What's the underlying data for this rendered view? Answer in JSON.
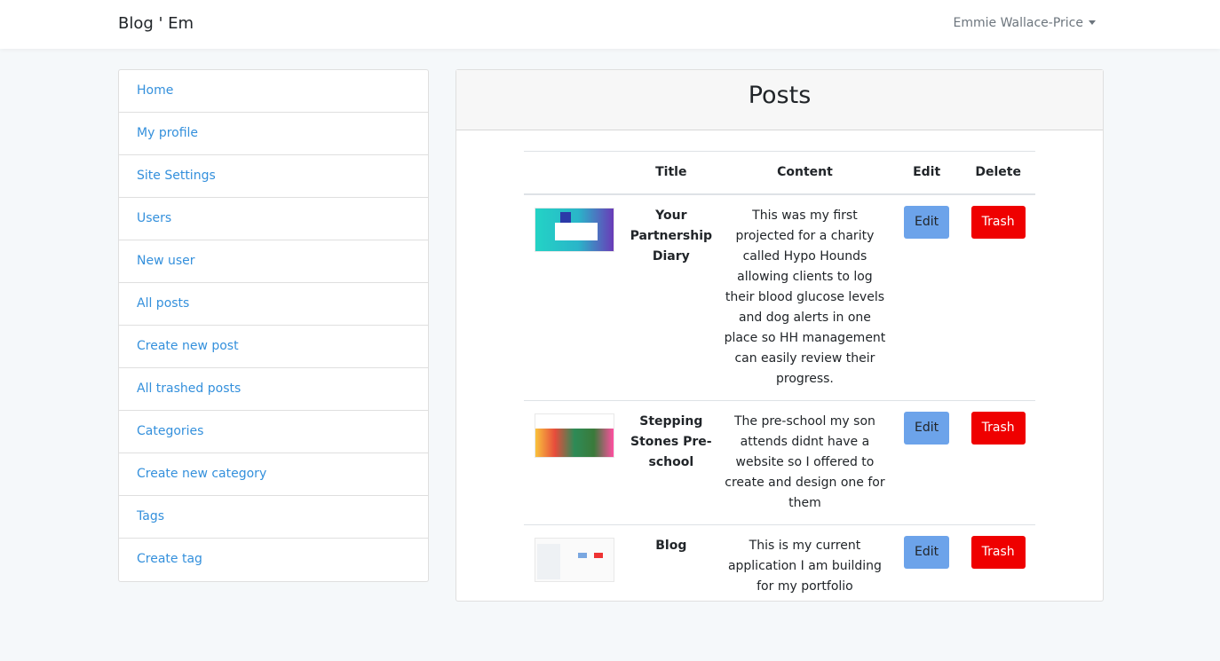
{
  "navbar": {
    "brand": "Blog ' Em",
    "user_name": "Emmie Wallace-Price"
  },
  "sidebar": {
    "items": [
      {
        "label": "Home"
      },
      {
        "label": "My profile"
      },
      {
        "label": "Site Settings"
      },
      {
        "label": "Users"
      },
      {
        "label": "New user"
      },
      {
        "label": "All posts"
      },
      {
        "label": "Create new post"
      },
      {
        "label": "All trashed posts"
      },
      {
        "label": "Categories"
      },
      {
        "label": "Create new category"
      },
      {
        "label": "Tags"
      },
      {
        "label": "Create tag"
      }
    ]
  },
  "posts": {
    "heading": "Posts",
    "columns": {
      "image": "",
      "title": "Title",
      "content": "Content",
      "edit": "Edit",
      "delete": "Delete"
    },
    "rows": [
      {
        "title": "Your Partnership Diary",
        "content": "This was my first projected for a charity called Hypo Hounds allowing clients to log their blood glucose levels and dog alerts in one place so HH management can easily review their progress.",
        "edit_label": "Edit",
        "trash_label": "Trash"
      },
      {
        "title": "Stepping Stones Pre-school",
        "content": "The pre-school my son attends didnt have a website so I offered to create and design one for them",
        "edit_label": "Edit",
        "trash_label": "Trash"
      },
      {
        "title": "Blog",
        "content": "This is my current application I am building for my portfolio",
        "edit_label": "Edit",
        "trash_label": "Trash"
      }
    ]
  },
  "colors": {
    "link": "#3490dc",
    "edit_button": "#6ca3ea",
    "trash_button": "#ef0000",
    "background": "#f5f8fa"
  }
}
